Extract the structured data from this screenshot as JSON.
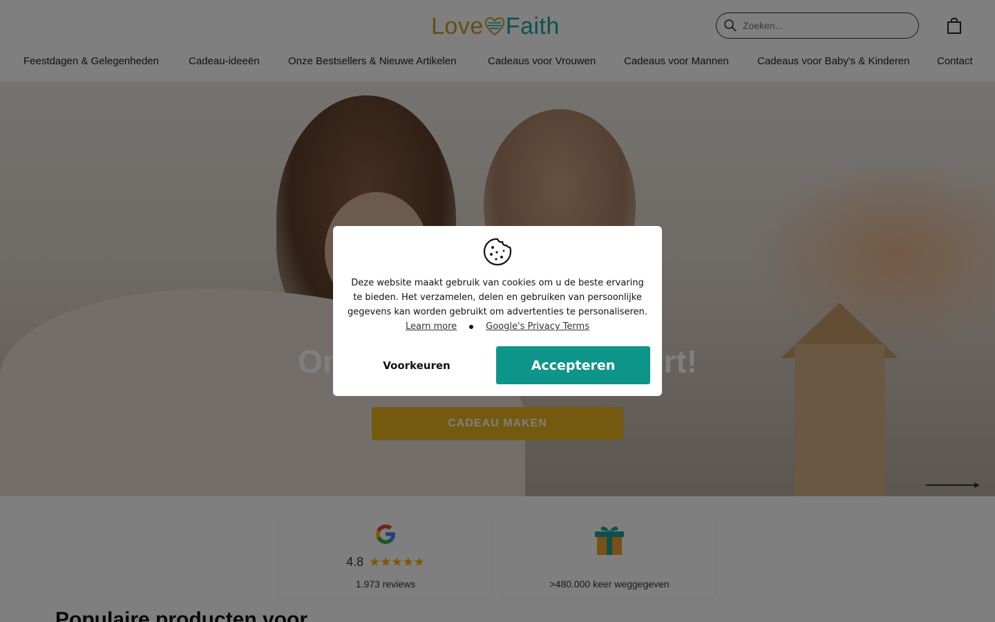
{
  "header": {
    "logo": {
      "part1": "Love",
      "part2": "Faith"
    },
    "search_placeholder": "Zoeken...",
    "nav": [
      {
        "label": "Feestdagen & Gelegenheden"
      },
      {
        "label": "Cadeau-ideeën"
      },
      {
        "label": "Onze Bestsellers & Nieuwe Artikelen"
      },
      {
        "label": "Cadeaus voor Vrouwen"
      },
      {
        "label": "Cadeaus voor Mannen"
      },
      {
        "label": "Cadeaus voor Baby's & Kinderen"
      },
      {
        "label": "Contact"
      }
    ]
  },
  "hero": {
    "title_left": "Onv",
    "title_right": "rt!",
    "button_label": "CADEAU MAKEN"
  },
  "trust": {
    "google": {
      "rating": "4.8",
      "stars": "★★★★★",
      "reviews": "1.973 reviews"
    },
    "gift": {
      "text": ">480.000 keer weggegeven"
    }
  },
  "section": {
    "title": "Populaire producten voor"
  },
  "cookie": {
    "text": "Deze website maakt gebruik van cookies om u de beste ervaring te bieden. Het verzamelen, delen en gebruiken van persoonlijke gegevens kan worden gebruikt om advertenties te personaliseren.",
    "learn_more": "Learn more",
    "privacy": "Google's Privacy Terms",
    "preferences_label": "Voorkeuren",
    "accept_label": "Accepteren"
  },
  "colors": {
    "accent": "#0e958a",
    "hero_button": "#e7b51f",
    "logo_gold": "#c89b2e",
    "logo_teal": "#1aa39b"
  }
}
